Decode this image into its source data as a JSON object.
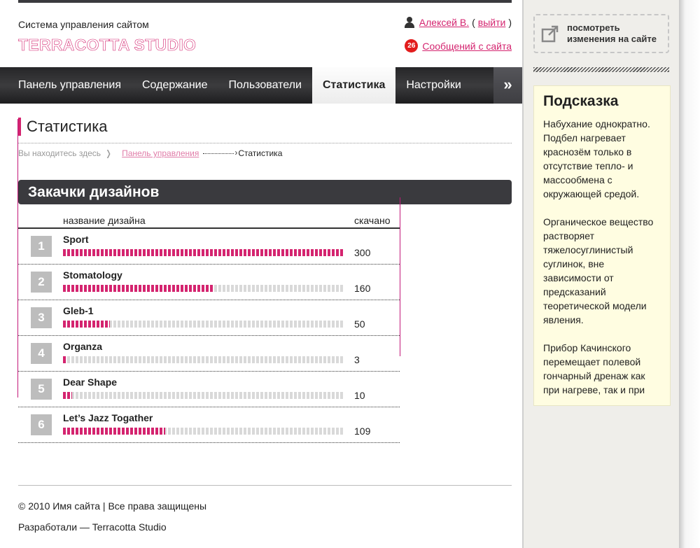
{
  "header": {
    "site_caption": "Система управления сайтом",
    "logo": "TERRACOTTA STUDIO",
    "user_name": "Алексей В.",
    "open_paren": "(",
    "logout": "выйти",
    "close_paren": ")",
    "messages_count": "26",
    "messages_label": "Сообщений с сайта"
  },
  "nav": {
    "items": [
      "Панель управления",
      "Содержание",
      "Пользователи",
      "Статистика",
      "Настройки"
    ],
    "active": "Статистика",
    "more": "»"
  },
  "page": {
    "title": "Статистика",
    "breadcrumb": {
      "here": "Вы находитесь здесь",
      "sep": "❭",
      "parent": "Панель управления",
      "current": "Статистика"
    },
    "section_title": "Закачки дизайнов"
  },
  "table": {
    "col_name": "название дизайна",
    "col_downloads": "скачано",
    "max": 300,
    "rows": [
      {
        "rank": "1",
        "name": "Sport",
        "downloads": 300
      },
      {
        "rank": "2",
        "name": "Stomatology",
        "downloads": 160
      },
      {
        "rank": "3",
        "name": "Gleb-1",
        "downloads": 50
      },
      {
        "rank": "4",
        "name": "Organza",
        "downloads": 3
      },
      {
        "rank": "5",
        "name": "Dear Shape",
        "downloads": 10
      },
      {
        "rank": "6",
        "name": "Let’s Jazz Togather",
        "downloads": 109
      }
    ]
  },
  "footer": {
    "copyright": "© 2010 Имя сайта | Все права защищены",
    "credits": "Разработали — Terracotta Studio"
  },
  "sidebar": {
    "view_button": "посмотреть\nизменения на сайте",
    "hint_title": "Подсказка",
    "hint_paragraphs": [
      "Набухание однократно. Подбел нагревает краснозём только в отсутствие тепло- и массообмена с окружающей средой.",
      "Органическое вещество растворяет тяжелосуглинистый суглинок, вне зависимости от предсказаний теоретической модели явления.",
      "Прибор Качинского перемещает полевой гончарный дренаж как при нагреве, так и при"
    ]
  },
  "colors": {
    "accent": "#d4246f",
    "dark": "#3a3a3e",
    "hint_bg": "#fffde1"
  }
}
